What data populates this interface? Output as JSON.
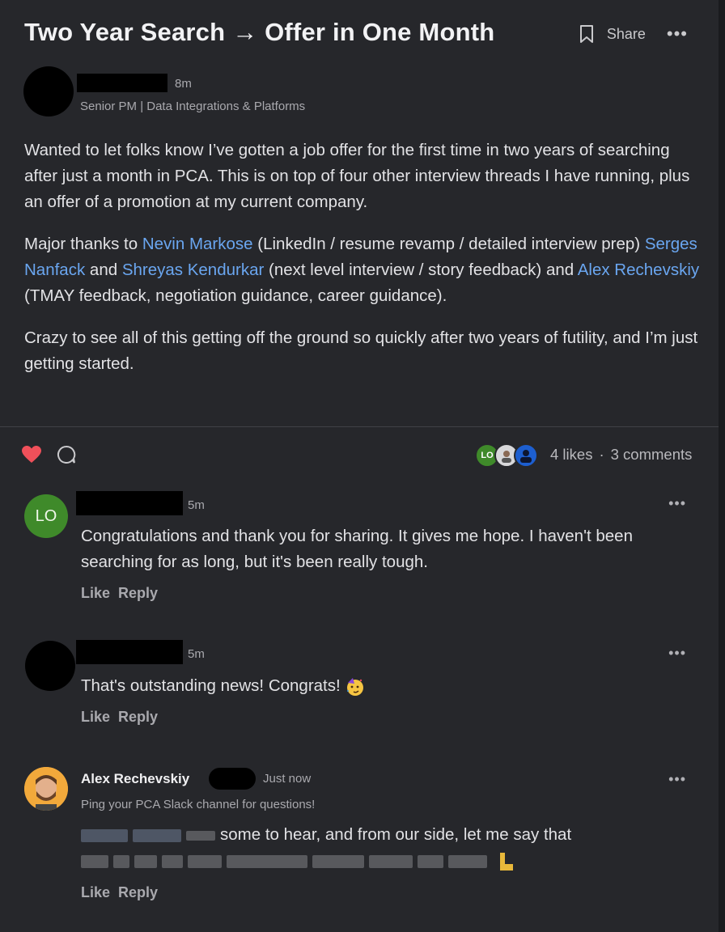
{
  "post": {
    "title": "Two Year Search → Offer in One Month",
    "share_label": "Share",
    "author_time": "8m",
    "author_subtitle": "Senior PM | Data Integrations & Platforms",
    "p1": "Wanted to let folks know I’ve gotten a job offer for the first time in two years of searching after just a month in PCA. This is on top of four other interview threads I have running, plus an offer of a promotion at my current company.",
    "p2_a": "Major thanks to ",
    "mention_1": "Nevin Markose",
    "p2_b": " (LinkedIn / resume revamp / detailed interview prep) ",
    "mention_2": "Serges Nanfack",
    "p2_c": " and ",
    "mention_3": "Shreyas Kendurkar",
    "p2_d": " (next level interview / story feedback) and ",
    "mention_4": "Alex Rechevskiy",
    "p2_e": " (TMAY feedback, negotiation guidance, career guidance).",
    "p3": "Crazy to see all of this getting off the ground so quickly after two years of futility, and I’m just getting started."
  },
  "engagement": {
    "liker_initials": "LO",
    "likes": "4 likes",
    "separator": "·",
    "comments": "3 comments"
  },
  "comments": [
    {
      "avatar_initials": "LO",
      "time": "5m",
      "text": "Congratulations and thank you for sharing. It gives me hope. I haven't been searching for as long, but it's been really tough.",
      "like": "Like",
      "reply": "Reply"
    },
    {
      "time": "5m",
      "text": "That's outstanding news! Congrats!",
      "like": "Like",
      "reply": "Reply"
    },
    {
      "author": "Alex Rechevskiy",
      "time": "Just now",
      "subtitle": "Ping your PCA Slack channel for questions!",
      "text_visible": "some to hear, and from our side, let me say that",
      "like": "Like",
      "reply": "Reply"
    }
  ],
  "colors": {
    "background": "#26272b",
    "mention": "#6aa6f0",
    "heart": "#f0505a",
    "lo_avatar": "#3f8a2a"
  },
  "icons": [
    "bookmark-icon",
    "more-icon",
    "heart-icon",
    "comment-icon",
    "party-face-emoji",
    "flexed-arm-emoji"
  ]
}
